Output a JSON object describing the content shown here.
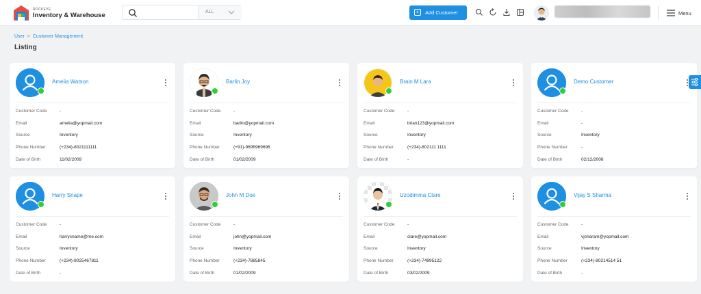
{
  "header": {
    "brand_small": "ROCKEYE",
    "brand_name": "Inventory & Warehouse",
    "search_value": "",
    "search_filter": "ALL",
    "add_button": "Add Customer",
    "menu_label": "Menu",
    "accent": "#1e8fe1"
  },
  "breadcrumb": {
    "root": "User",
    "current": "Customer Management"
  },
  "page_title": "Listing",
  "fields": {
    "code": "Customer Code",
    "email": "Email",
    "source": "Source",
    "phone": "Phone Number",
    "dob": "Date of Birth"
  },
  "customers": [
    {
      "name": "Amelia Watson",
      "avatar": "default",
      "code": "-",
      "email": "amelia@yopmail.com",
      "source": "Inventory",
      "phone": "(+234)-8021111111",
      "dob": "11/02/2009"
    },
    {
      "name": "Barlin Joy",
      "avatar": "photo-cartoon",
      "code": "-",
      "email": "barlin@yopmail.com",
      "source": "Inventory",
      "phone": "(+91)-9696969696",
      "dob": "01/02/2009"
    },
    {
      "name": "Brain M Lara",
      "avatar": "photo-yellow",
      "code": "-",
      "email": "brian123@yopmail.com",
      "source": "Inventory",
      "phone": "(+234)-802111 1111",
      "dob": "-"
    },
    {
      "name": "Demo Customer",
      "avatar": "default",
      "code": "-",
      "email": "-",
      "source": "Inventory",
      "phone": "-",
      "dob": "02/12/2008"
    },
    {
      "name": "Harry Snape",
      "avatar": "default",
      "code": "-",
      "email": "harrysname@me.com",
      "source": "Inventory",
      "phone": "(+234)-8025467811",
      "dob": "-"
    },
    {
      "name": "John M Doe",
      "avatar": "photo-real",
      "code": "-",
      "email": "john@yopmail.com",
      "source": "Inventory",
      "phone": "(+234)-7885845",
      "dob": "01/02/2009"
    },
    {
      "name": "Uzodimma Clare",
      "avatar": "photo-suit",
      "code": "-",
      "email": "clare@yopmail.com",
      "source": "Inventory",
      "phone": "(+234)-74995122",
      "dob": "03/02/2009"
    },
    {
      "name": "Vijay S Sharma",
      "avatar": "default",
      "code": "-",
      "email": "vjsharam@yopmail.com",
      "source": "Inventory",
      "phone": "(+234)-80214514 51",
      "dob": "-"
    }
  ]
}
